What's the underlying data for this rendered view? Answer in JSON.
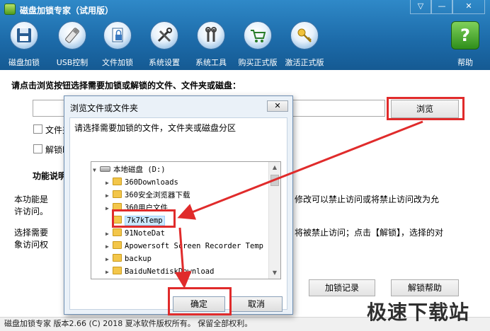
{
  "window": {
    "title": "磁盘加锁专家（试用版）",
    "controls": {
      "menu": "▽",
      "minimize": "—",
      "close": "✕"
    }
  },
  "toolbar": {
    "items": [
      {
        "label": "磁盘加锁",
        "icon": "floppy-disk-icon"
      },
      {
        "label": "USB控制",
        "icon": "usb-drive-icon"
      },
      {
        "label": "文件加锁",
        "icon": "file-lock-icon"
      },
      {
        "label": "系统设置",
        "icon": "tools-icon"
      },
      {
        "label": "系统工具",
        "icon": "wrench-icon"
      },
      {
        "label": "购买正式版",
        "icon": "shopping-cart-icon"
      },
      {
        "label": "激活正式版",
        "icon": "key-icon"
      },
      {
        "label": "帮助",
        "icon": "help-icon"
      }
    ]
  },
  "main": {
    "prompt": "请点击浏览按钮选择需要加锁或解锁的文件、文件夹或磁盘：",
    "path_value": "",
    "browse_label": "浏览",
    "checkbox1_label": "文件夹",
    "checkbox2_label": "解锁时",
    "func_title": "功能说明",
    "desc1_left": "本功能是",
    "desc1_right": "修改可以禁止访问或将禁止访问改为允",
    "desc1_line2": "许访问。",
    "desc2_left": "选择需要",
    "desc2_right": "将被禁止访问；点击【解锁】，选择的对",
    "desc2_line2": "象访问权",
    "lock_log_label": "加锁记录",
    "unlock_help_label": "解锁帮助"
  },
  "dialog": {
    "title": "浏览文件或文件夹",
    "close": "✕",
    "prompt": "请选择需要加锁的文件，文件夹或磁盘分区",
    "tree": [
      {
        "label": "本地磁盘 (D:)",
        "type": "drive",
        "expanded": true
      },
      {
        "label": "360Downloads",
        "type": "folder"
      },
      {
        "label": "360安全浏览器下载",
        "type": "folder"
      },
      {
        "label": "360用户文件",
        "type": "folder"
      },
      {
        "label": "7k7kTemp",
        "type": "folder",
        "selected": true
      },
      {
        "label": "91NoteDat",
        "type": "folder"
      },
      {
        "label": "Apowersoft Screen Recorder Temp",
        "type": "folder"
      },
      {
        "label": "backup",
        "type": "folder"
      },
      {
        "label": "BaiduNetdiskDownload",
        "type": "folder"
      }
    ],
    "ok_label": "确定",
    "cancel_label": "取消"
  },
  "statusbar": {
    "text": "磁盘加锁专家  版本2.66 (C)  2018 夏冰软件版权所有。 保留全部权利。"
  },
  "watermark": "极速下载站",
  "colors": {
    "toolbar": "#1c6aa8",
    "highlight": "#e02b2b",
    "selection": "#cce8ff"
  }
}
